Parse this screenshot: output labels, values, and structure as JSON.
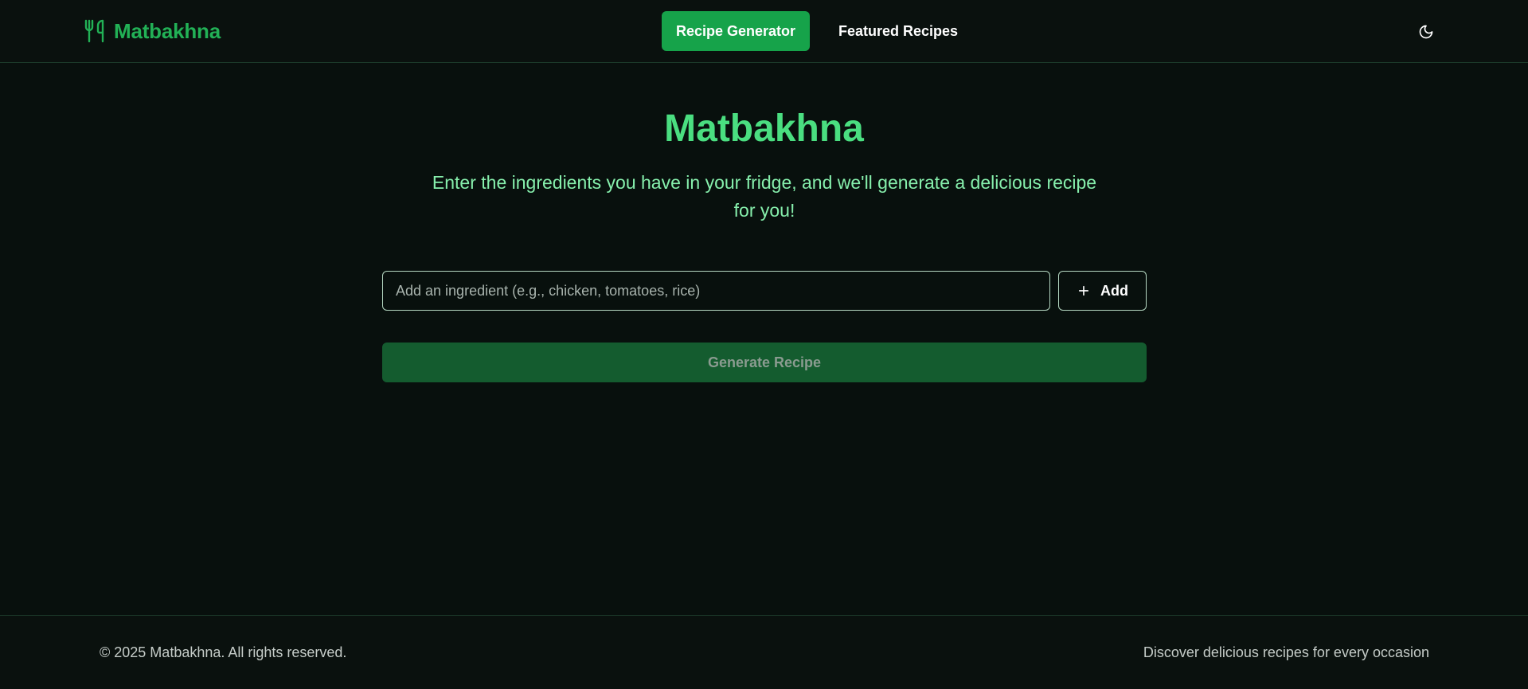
{
  "header": {
    "brand_name": "Matbakhna",
    "brand_icon": "utensils-icon",
    "nav": [
      {
        "label": "Recipe Generator",
        "active": true
      },
      {
        "label": "Featured Recipes",
        "active": false
      }
    ],
    "theme_toggle_icon": "moon-icon"
  },
  "hero": {
    "title": "Matbakhna",
    "subtitle": "Enter the ingredients you have in your fridge, and we'll generate a delicious recipe for you!"
  },
  "ingredient_form": {
    "input_value": "",
    "input_placeholder": "Add an ingredient (e.g., chicken, tomatoes, rice)",
    "add_label": "Add",
    "add_icon": "plus-icon",
    "generate_label": "Generate Recipe",
    "generate_disabled": true
  },
  "footer": {
    "copyright": "© 2025 Matbakhna. All rights reserved.",
    "tagline": "Discover delicious recipes for every occasion"
  },
  "colors": {
    "background": "#08100d",
    "accent": "#16a34a",
    "brand_text": "#22b156",
    "title": "#4ade80",
    "subtitle": "#86efac",
    "generate_disabled_bg": "#145c2f"
  }
}
